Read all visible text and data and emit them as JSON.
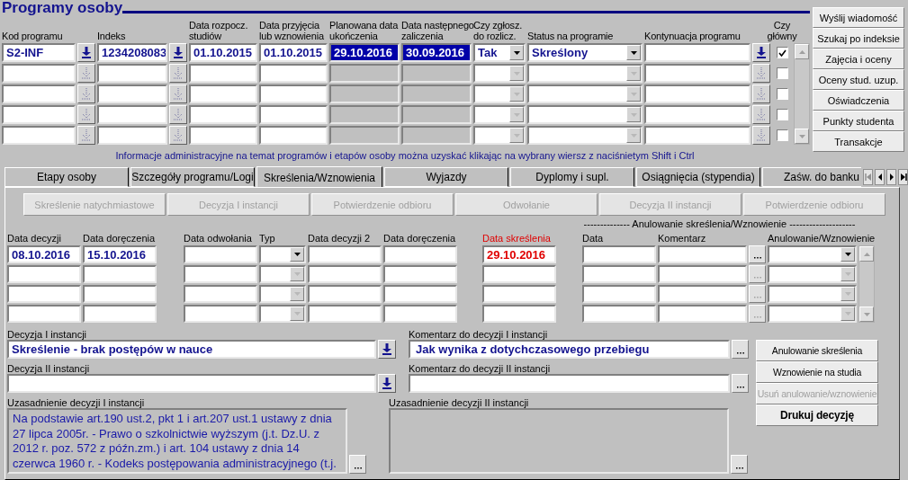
{
  "title": "Programy osoby",
  "side_buttons": [
    "Wyślij wiadomość",
    "Szukaj po indeksie",
    "Zajęcia i oceny",
    "Oceny stud. uzup.",
    "Oświadczenia",
    "Punkty studenta",
    "Transakcje"
  ],
  "programs": {
    "columns": [
      "Kod programu",
      "Indeks",
      "Data rozpocz.\nstudiów",
      "Data przyjęcia\nlub wznowienia",
      "Planowana data\nukończenia",
      "Data następnego\nzaliczenia",
      "Czy zgłosz.\ndo rozlicz.",
      "Status na programie",
      "Kontynuacja programu",
      "Czy\ngłówny"
    ],
    "rows": [
      {
        "selected": true,
        "code": "S2-INF",
        "index": "1234208083",
        "start_date": "01.10.2015",
        "admission_date": "01.10.2015",
        "planned_end": "29.10.2016",
        "next_pass": "30.09.2016",
        "reported": "Tak",
        "status": "Skreślony",
        "main": true
      },
      {
        "selected": false,
        "main": false
      },
      {
        "selected": false,
        "main": false
      },
      {
        "selected": false,
        "main": false
      },
      {
        "selected": false,
        "main": false
      }
    ]
  },
  "info": "Informacje administracyjne na temat programów i etapów osoby można uzyskać klikając na wybrany wiersz z naciśnietym Shift i Ctrl",
  "tabs": [
    {
      "label": "Etapy osoby",
      "selected": false
    },
    {
      "label": "Szczegóły programu/Logi",
      "selected": false
    },
    {
      "label": "Skreślenia/Wznowienia",
      "selected": true
    },
    {
      "label": "Wyjazdy",
      "selected": false
    },
    {
      "label": "Dyplomy i supl.",
      "selected": false
    },
    {
      "label": "Osiągnięcia (stypendia)",
      "selected": false
    },
    {
      "label": "Zaśw. do banku",
      "selected": false
    }
  ],
  "actions": [
    {
      "label": "Skreślenie natychmiastowe",
      "disabled": true
    },
    {
      "label": "Decyzja I instancji",
      "disabled": true
    },
    {
      "label": "Potwierdzenie odbioru",
      "disabled": true
    },
    {
      "label": "Odwołanie",
      "disabled": true
    },
    {
      "label": "Decyzja II instancji",
      "disabled": true
    },
    {
      "label": "Potwierdzenie odbioru",
      "disabled": true
    }
  ],
  "decisions": {
    "group_header": "-------------- Anulowanie skreślenia/Wznowienie --------------------",
    "columns": [
      {
        "label": "Data decyzji",
        "alert": false
      },
      {
        "label": "Data doręczenia",
        "alert": false
      },
      {
        "label": "Data odwołania",
        "alert": false
      },
      {
        "label": "Typ",
        "alert": false
      },
      {
        "label": "Data decyzji 2",
        "alert": false
      },
      {
        "label": "Data doręczenia",
        "alert": false
      },
      {
        "label": "Data skreślenia",
        "alert": true
      },
      {
        "label": "Data",
        "alert": false
      },
      {
        "label": "Komentarz",
        "alert": false
      },
      {
        "label": "Anulowanie/Wznowienie",
        "alert": false
      }
    ],
    "rows": [
      {
        "selected": true,
        "decision_date": "08.10.2016",
        "delivery_date": "15.10.2016",
        "removal_date": "29.10.2016"
      },
      {
        "selected": false
      },
      {
        "selected": false
      },
      {
        "selected": false
      }
    ]
  },
  "decision_1": {
    "label": "Decyzja I instancji",
    "value": "Skreślenie - brak postępów w nauce"
  },
  "comment_1": {
    "label": "Komentarz do decyzji I instancji",
    "value": "Jak wynika z dotychczasowego przebiegu"
  },
  "decision_2": {
    "label": "Decyzja II instancji"
  },
  "comment_2": {
    "label": "Komentarz do decyzji II instancji"
  },
  "justification_1": {
    "label": "Uzasadnienie decyzji I instancji",
    "value": "Na podstawie art.190 ust.2, pkt 1 i art.207 ust.1 ustawy z dnia\n27 lipca 2005r. - Prawo o szkolnictwie wyższym (j.t. Dz.U. z\n2012 r. poz. 572 z późn.zm.) i art. 104 ustawy z dnia 14\nczerwca 1960 r. - Kodeks postępowania administracyjnego (t.j."
  },
  "justification_2": {
    "label": "Uzasadnienie decyzji II instancji"
  },
  "decision_buttons": [
    {
      "label": "Anulowanie skreślenia",
      "disabled": false,
      "emphasized": false
    },
    {
      "label": "Wznowienie na studia",
      "disabled": false,
      "emphasized": false
    },
    {
      "label": "Usuń anulowanie/wznowienie",
      "disabled": true,
      "emphasized": false
    },
    {
      "label": "Drukuj decyzję",
      "disabled": false,
      "emphasized": true
    }
  ]
}
